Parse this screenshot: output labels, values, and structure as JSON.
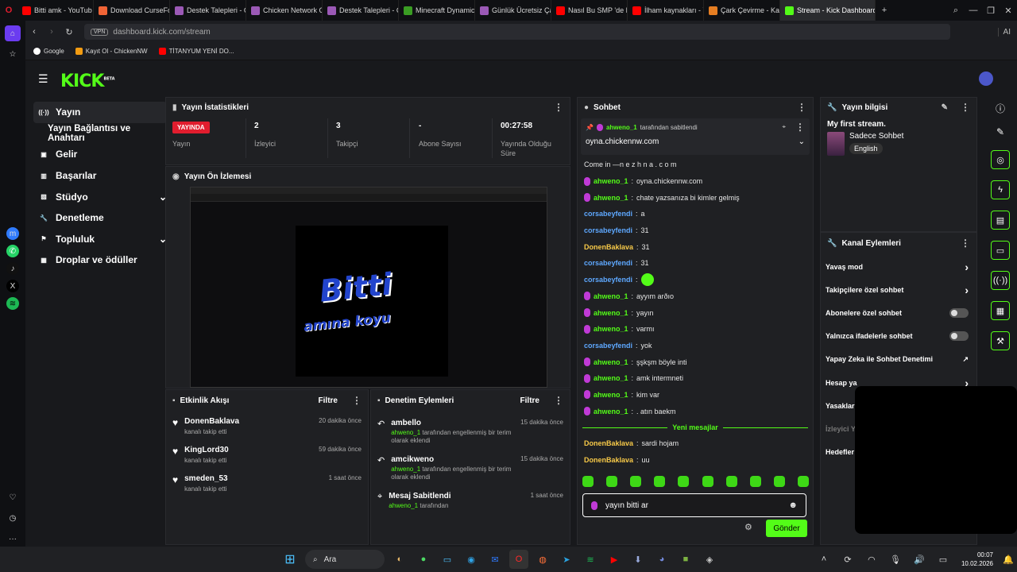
{
  "browser": {
    "tabs": [
      {
        "label": "Bitti amk - YouTub",
        "color": "#ff0000"
      },
      {
        "label": "Download CurseForg",
        "color": "#f16436"
      },
      {
        "label": "Destek Talepleri - Chi",
        "color": "#9b59b6"
      },
      {
        "label": "Chicken Network Co",
        "color": "#9b59b6"
      },
      {
        "label": "Destek Talepleri - Chi",
        "color": "#9b59b6"
      },
      {
        "label": "Minecraft Dynamic M",
        "color": "#3a9d23"
      },
      {
        "label": "Günlük Ücretsiz Çark",
        "color": "#9b59b6"
      },
      {
        "label": "Nasıl Bu SMP 'de HEP",
        "color": "#ff0000"
      },
      {
        "label": "İlham kaynakları - You",
        "color": "#ff0000"
      },
      {
        "label": "Çark Çevirme - Karar",
        "color": "#e67e22"
      },
      {
        "label": "Stream - Kick Dashboard",
        "color": "#53fc18",
        "active": true
      }
    ],
    "url": "dashboard.kick.com/stream",
    "vpn": "VPN",
    "ai_label": "AI",
    "bookmarks": [
      "Google",
      "Kayıt Ol - ChickenNW",
      "TİTANYUM YENİ DO..."
    ]
  },
  "logo": "KICK",
  "logo_beta": "BETA",
  "nav": [
    {
      "label": "Yayın",
      "icon": "broadcast-icon",
      "active": true
    },
    {
      "label": "Yayın Bağlantısı ve Anahtarı",
      "icon": ""
    },
    {
      "label": "Gelir",
      "icon": "wallet-icon"
    },
    {
      "label": "Başarılar",
      "icon": "trophy-icon"
    },
    {
      "label": "Stüdyo",
      "icon": "studio-icon",
      "chevron": true
    },
    {
      "label": "Denetleme",
      "icon": "wrench-icon"
    },
    {
      "label": "Topluluk",
      "icon": "community-icon",
      "chevron": true
    },
    {
      "label": "Droplar ve ödüller",
      "icon": "gift-icon"
    }
  ],
  "stats": {
    "title": "Yayın İstatistikleri",
    "live_badge": "YAYINDA",
    "live_label": "Yayın",
    "viewers": "2",
    "viewers_label": "İzleyici",
    "followers": "3",
    "followers_label": "Takipçi",
    "subs": "-",
    "subs_label": "Abone Sayısı",
    "uptime": "00:27:58",
    "uptime_label": "Yayında Olduğu Süre"
  },
  "preview": {
    "title": "Yayın Ön İzlemesi",
    "overlay_line1": "Bitti",
    "overlay_line2": "amına koyu"
  },
  "activity": {
    "title": "Etkinlik Akışı",
    "filter": "Filtre",
    "items": [
      {
        "name": "DonenBaklava",
        "desc": "kanalı takip etti",
        "time": "20 dakika önce"
      },
      {
        "name": "KingLord30",
        "desc": "kanalı takip etti",
        "time": "59 dakika önce"
      },
      {
        "name": "smeden_53",
        "desc": "kanalı takip etti",
        "time": "1 saat önce"
      }
    ]
  },
  "moderation": {
    "title": "Denetim Eylemleri",
    "filter": "Filtre",
    "items": [
      {
        "name": "ambello",
        "user": "ahweno_1",
        "desc": "tarafından engellenmiş bir terim olarak eklendi",
        "time": "15 dakika önce"
      },
      {
        "name": "amcikweno",
        "user": "ahweno_1",
        "desc": "tarafından engellenmiş bir terim olarak eklendi",
        "time": "15 dakika önce"
      },
      {
        "name": "Mesaj Sabitlendi",
        "user": "ahweno_1",
        "desc": "tarafından",
        "time": "1 saat önce"
      }
    ]
  },
  "chat": {
    "title": "Sohbet",
    "pinned_by": "ahweno_1",
    "pinned_by_suffix": "tarafından sabitlendi",
    "pinned_msg": "oyna.chickennw.com",
    "come_in": "Come in —n e z h n a . c o m",
    "messages": [
      {
        "user": "ahweno_1",
        "text": "oyna.chickennw.com",
        "c": "u1",
        "badge": true
      },
      {
        "user": "ahweno_1",
        "text": "chate yazsanıza bi kimler gelmiş",
        "c": "u1",
        "badge": true
      },
      {
        "user": "corsabeyfendi",
        "text": "a",
        "c": "u2"
      },
      {
        "user": "corsabeyfendi",
        "text": "31",
        "c": "u2"
      },
      {
        "user": "DonenBaklava",
        "text": "31",
        "c": "u3"
      },
      {
        "user": "corsabeyfendi",
        "text": "31",
        "c": "u2"
      },
      {
        "user": "corsabeyfendi",
        "text": "",
        "c": "u2",
        "emote": true
      },
      {
        "user": "ahweno_1",
        "text": "ayyım arðıo",
        "c": "u1",
        "badge": true
      },
      {
        "user": "ahweno_1",
        "text": "yayın",
        "c": "u1",
        "badge": true
      },
      {
        "user": "ahweno_1",
        "text": "varmı",
        "c": "u1",
        "badge": true
      },
      {
        "user": "corsabeyfendi",
        "text": "yok",
        "c": "u2"
      },
      {
        "user": "ahweno_1",
        "text": "şşkşm böyle inti",
        "c": "u1",
        "badge": true
      },
      {
        "user": "ahweno_1",
        "text": "amk intermneti",
        "c": "u1",
        "badge": true
      },
      {
        "user": "ahweno_1",
        "text": "kim var",
        "c": "u1",
        "badge": true
      },
      {
        "user": "ahweno_1",
        "text": ". atın baekm",
        "c": "u1",
        "badge": true
      }
    ],
    "new_messages": "Yeni mesajlar",
    "new": [
      {
        "user": "DonenBaklava",
        "text": "sardi hojam"
      },
      {
        "user": "DonenBaklava",
        "text": "uu"
      }
    ],
    "input_value": "yayın bitti ar",
    "send": "Gönder"
  },
  "stream_info": {
    "title": "Yayın bilgisi",
    "stream_title": "My first stream.",
    "category": "Sadece Sohbet",
    "language": "English"
  },
  "channel_actions": {
    "title": "Kanal Eylemleri",
    "rows": [
      {
        "label": "Yavaş mod",
        "type": "chevron"
      },
      {
        "label": "Takipçilere özel sohbet",
        "type": "chevron"
      },
      {
        "label": "Abonelere özel sohbet",
        "type": "toggle"
      },
      {
        "label": "Yalnızca ifadelerle sohbet",
        "type": "toggle"
      },
      {
        "label": "Yapay Zeka ile Sohbet Denetimi",
        "type": "external"
      },
      {
        "label": "Hesap ya",
        "type": "chevron"
      },
      {
        "label": "Yasaklar",
        "type": ""
      },
      {
        "label": "İzleyici Y",
        "type": "",
        "dim": true
      },
      {
        "label": "Hedefler",
        "type": ""
      }
    ]
  },
  "taskbar": {
    "search": "Ara",
    "time": "00:07",
    "date": "10.02.2026"
  }
}
